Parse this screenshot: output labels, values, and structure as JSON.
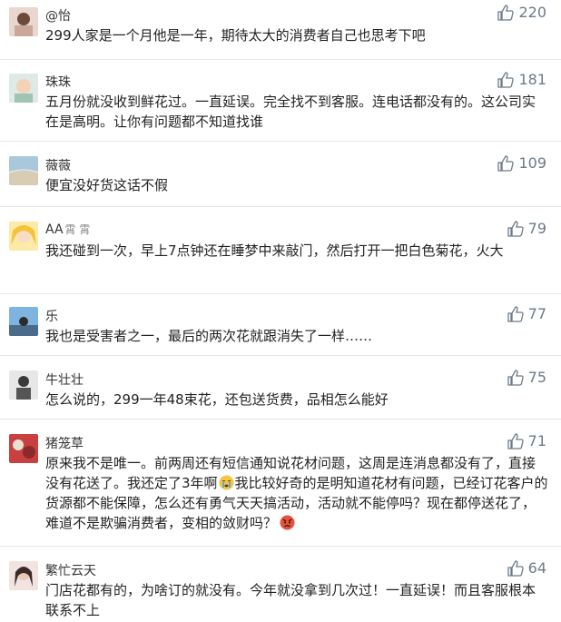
{
  "comments": [
    {
      "name": "@怡",
      "name_deco": "",
      "text": "299人家是一个月他是一年，期待太大的消费者自己也思考下吧",
      "likes": "220",
      "avatar": "avatar-1"
    },
    {
      "name": "珠珠",
      "name_deco": "",
      "text": "五月份就没收到鲜花过。一直延误。完全找不到客服。连电话都没有的。这公司实在是高明。让你有问题都不知道找谁",
      "likes": "181",
      "avatar": "avatar-2"
    },
    {
      "name": "薇薇",
      "name_deco": "",
      "text": "便宜没好货这话不假",
      "likes": "109",
      "avatar": "avatar-3"
    },
    {
      "name": "AA",
      "name_deco": "霄 霄",
      "text": "我还碰到一次，早上7点钟还在睡梦中来敲门，然后打开一把白色菊花，火大",
      "likes": "79",
      "avatar": "avatar-4"
    },
    {
      "name": "乐",
      "name_deco": "",
      "text": "我也是受害者之一，最后的两次花就跟消失了一样……",
      "likes": "77",
      "avatar": "avatar-5"
    },
    {
      "name": "牛壮壮",
      "name_deco": "",
      "text": "怎么说的，299一年48束花，还包送货费，品相怎么能好",
      "likes": "75",
      "avatar": "avatar-6"
    },
    {
      "name": "猪笼草",
      "name_deco": "",
      "text_parts": [
        "原来我不是唯一。前两周还有短信通知说花材问题，这周是连消息都没有了，直接没有花送了。我还定了3年啊",
        "我比较好奇的是明知道花材有问题，已经订花客户的货源都不能保障，怎么还有勇气天天搞活动，活动就不能停吗？现在都停送花了，难道不是欺骗消费者，变相的敛财吗？"
      ],
      "likes": "71",
      "avatar": "avatar-7"
    },
    {
      "name": "繁忙云天",
      "name_deco": "",
      "text": "门店花都有的，为啥订的就没有。今年就没拿到几次过！一直延误！而且客服根本联系不上",
      "likes": "64",
      "avatar": "avatar-8"
    }
  ],
  "colors": {
    "like": "#6c7a89",
    "divider": "#e6e6e6",
    "text": "#222222"
  }
}
